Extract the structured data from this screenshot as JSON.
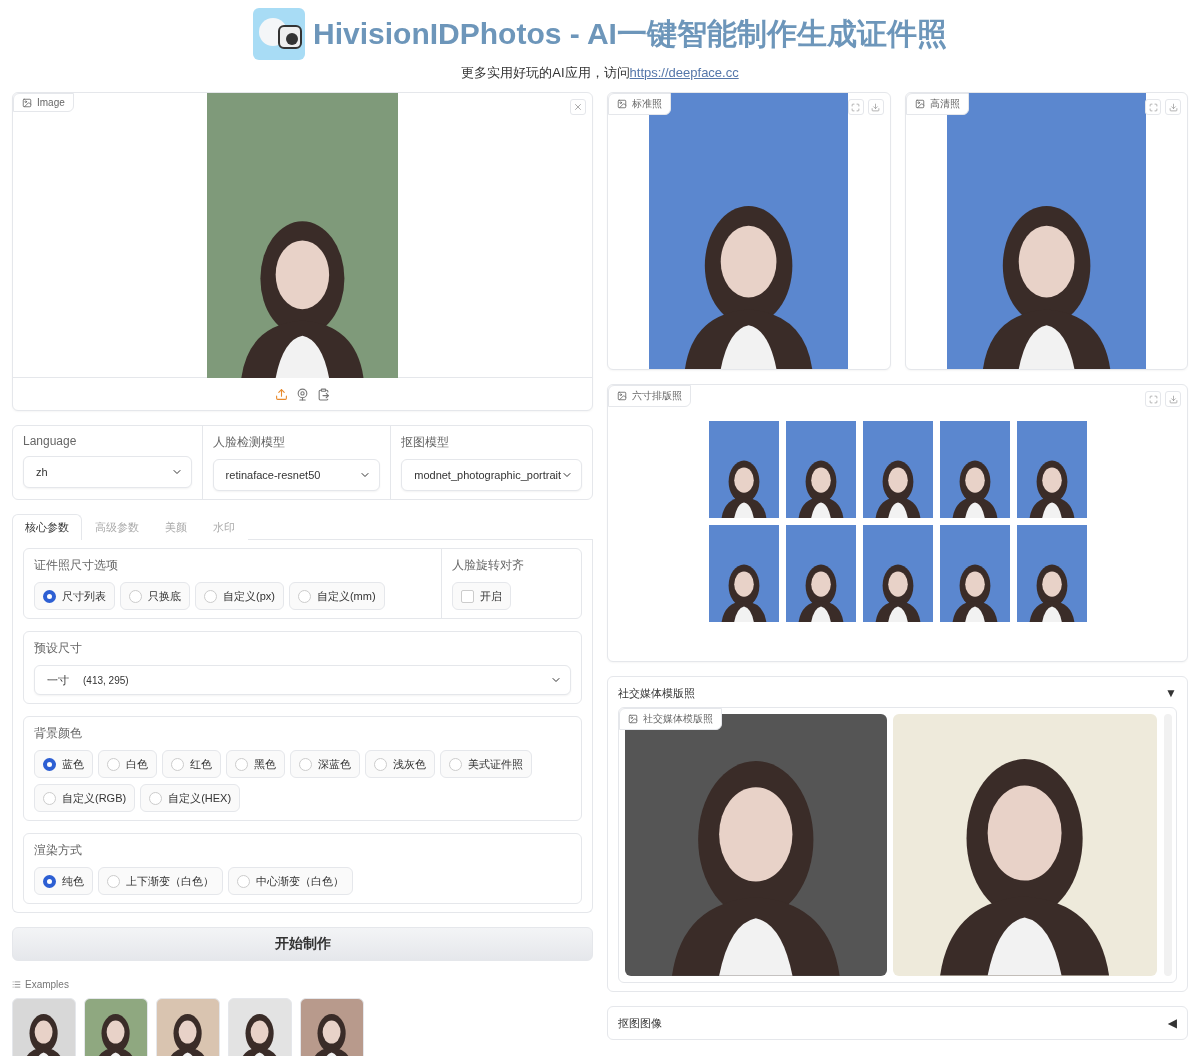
{
  "header": {
    "title": "HivisionIDPhotos - AI一键智能制作生成证件照",
    "subtitle": "更多实用好玩的AI应用，访问",
    "link": "https://deepface.cc"
  },
  "input_image": {
    "label": "Image"
  },
  "dropdowns": [
    {
      "label": "Language",
      "value": "zh"
    },
    {
      "label": "人脸检测模型",
      "value": "retinaface-resnet50"
    },
    {
      "label": "抠图模型",
      "value": "modnet_photographic_portrait"
    }
  ],
  "tabs": [
    {
      "label": "核心参数",
      "selected": true
    },
    {
      "label": "高级参数",
      "selected": false
    },
    {
      "label": "美颜",
      "selected": false
    },
    {
      "label": "水印",
      "selected": false
    }
  ],
  "size_options": {
    "label": "证件照尺寸选项",
    "options": [
      {
        "label": "尺寸列表",
        "selected": true
      },
      {
        "label": "只换底",
        "selected": false
      },
      {
        "label": "自定义(px)",
        "selected": false
      },
      {
        "label": "自定义(mm)",
        "selected": false
      }
    ]
  },
  "face_align": {
    "label": "人脸旋转对齐",
    "option": "开启",
    "checked": false
  },
  "preset_size": {
    "label": "预设尺寸",
    "value": "一寸",
    "detail": "(413, 295)"
  },
  "background_color": {
    "label": "背景颜色",
    "options": [
      {
        "label": "蓝色",
        "selected": true
      },
      {
        "label": "白色",
        "selected": false
      },
      {
        "label": "红色",
        "selected": false
      },
      {
        "label": "黑色",
        "selected": false
      },
      {
        "label": "深蓝色",
        "selected": false
      },
      {
        "label": "浅灰色",
        "selected": false
      },
      {
        "label": "美式证件照",
        "selected": false
      },
      {
        "label": "自定义(RGB)",
        "selected": false
      },
      {
        "label": "自定义(HEX)",
        "selected": false
      }
    ]
  },
  "render_mode": {
    "label": "渲染方式",
    "options": [
      {
        "label": "纯色",
        "selected": true
      },
      {
        "label": "上下渐变（白色）",
        "selected": false
      },
      {
        "label": "中心渐变（白色）",
        "selected": false
      }
    ]
  },
  "submit_button": "开始制作",
  "examples": {
    "label": "Examples"
  },
  "outputs": [
    {
      "label": "标准照"
    },
    {
      "label": "高清照"
    }
  ],
  "layout_photo": {
    "label": "六寸排版照"
  },
  "accordions": [
    {
      "title": "社交媒体模版照",
      "toggle": "▼",
      "expanded": true,
      "gallery_label": "社交媒体模版照"
    },
    {
      "title": "抠图图像",
      "toggle": "◀",
      "expanded": false
    }
  ]
}
